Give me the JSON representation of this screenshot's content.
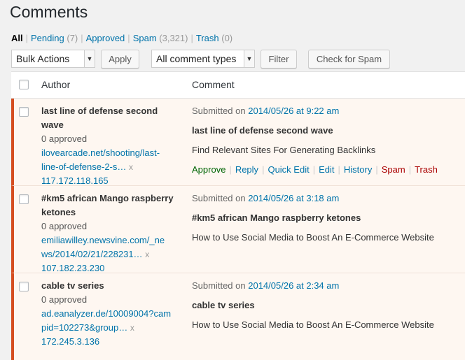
{
  "page_title": "Comments",
  "filters": [
    {
      "label": "All",
      "count": "",
      "current": true
    },
    {
      "label": "Pending",
      "count": "(7)",
      "current": false
    },
    {
      "label": "Approved",
      "count": "",
      "current": false
    },
    {
      "label": "Spam",
      "count": "(3,321)",
      "current": false
    },
    {
      "label": "Trash",
      "count": "(0)",
      "current": false
    }
  ],
  "toolbar": {
    "bulk_actions": "Bulk Actions",
    "apply": "Apply",
    "comment_types": "All comment types",
    "filter": "Filter",
    "check_spam": "Check for Spam"
  },
  "columns": {
    "author": "Author",
    "comment": "Comment"
  },
  "rows": [
    {
      "author_name_1": "last line of defense second",
      "author_name_2": "wave",
      "approved": "0 approved",
      "url_1": "ilovearcade.net/shooting/last-",
      "url_2": "line-of-defense-2-s…",
      "ip": "117.172.118.165",
      "submitted_prefix": "Submitted on",
      "submitted_date": "2014/05/26 at 9:22 am",
      "title": "last line of defense second wave",
      "text": "Find Relevant Sites For Generating Backlinks",
      "show_actions": true
    },
    {
      "author_name_1": "#km5 african Mango raspberry",
      "author_name_2": "ketones",
      "approved": "0 approved",
      "url_1": "emiliawilley.newsvine.com/_ne",
      "url_2": "ws/2014/02/21/228231…",
      "ip": "107.182.23.230",
      "submitted_prefix": "Submitted on",
      "submitted_date": "2014/05/26 at 3:18 am",
      "title": "#km5 african Mango raspberry ketones",
      "text": "How to Use Social Media to Boost An E-Commerce Website",
      "show_actions": false
    },
    {
      "author_name_1": "cable tv series",
      "author_name_2": "",
      "approved": "0 approved",
      "url_1": "ad.eanalyzer.de/10009004?cam",
      "url_2": "pid=102273&group…",
      "ip": "172.245.3.136",
      "submitted_prefix": "Submitted on",
      "submitted_date": "2014/05/26 at 2:34 am",
      "title": "cable tv series",
      "text": "How to Use Social Media to Boost An E-Commerce Website",
      "show_actions": false
    }
  ],
  "row_actions": [
    {
      "label": "Approve",
      "color": "#006505"
    },
    {
      "label": "Reply",
      "color": "#0073aa"
    },
    {
      "label": "Quick Edit",
      "color": "#0073aa"
    },
    {
      "label": "Edit",
      "color": "#0073aa"
    },
    {
      "label": "History",
      "color": "#0073aa"
    },
    {
      "label": "Spam",
      "color": "#a00"
    },
    {
      "label": "Trash",
      "color": "#a00"
    }
  ],
  "x_glyph": "x",
  "select_arrow": "▼",
  "colors": {
    "unapproved_border": "#d54e21",
    "unapproved_bg": "#fef7f1",
    "link": "#0073aa"
  }
}
